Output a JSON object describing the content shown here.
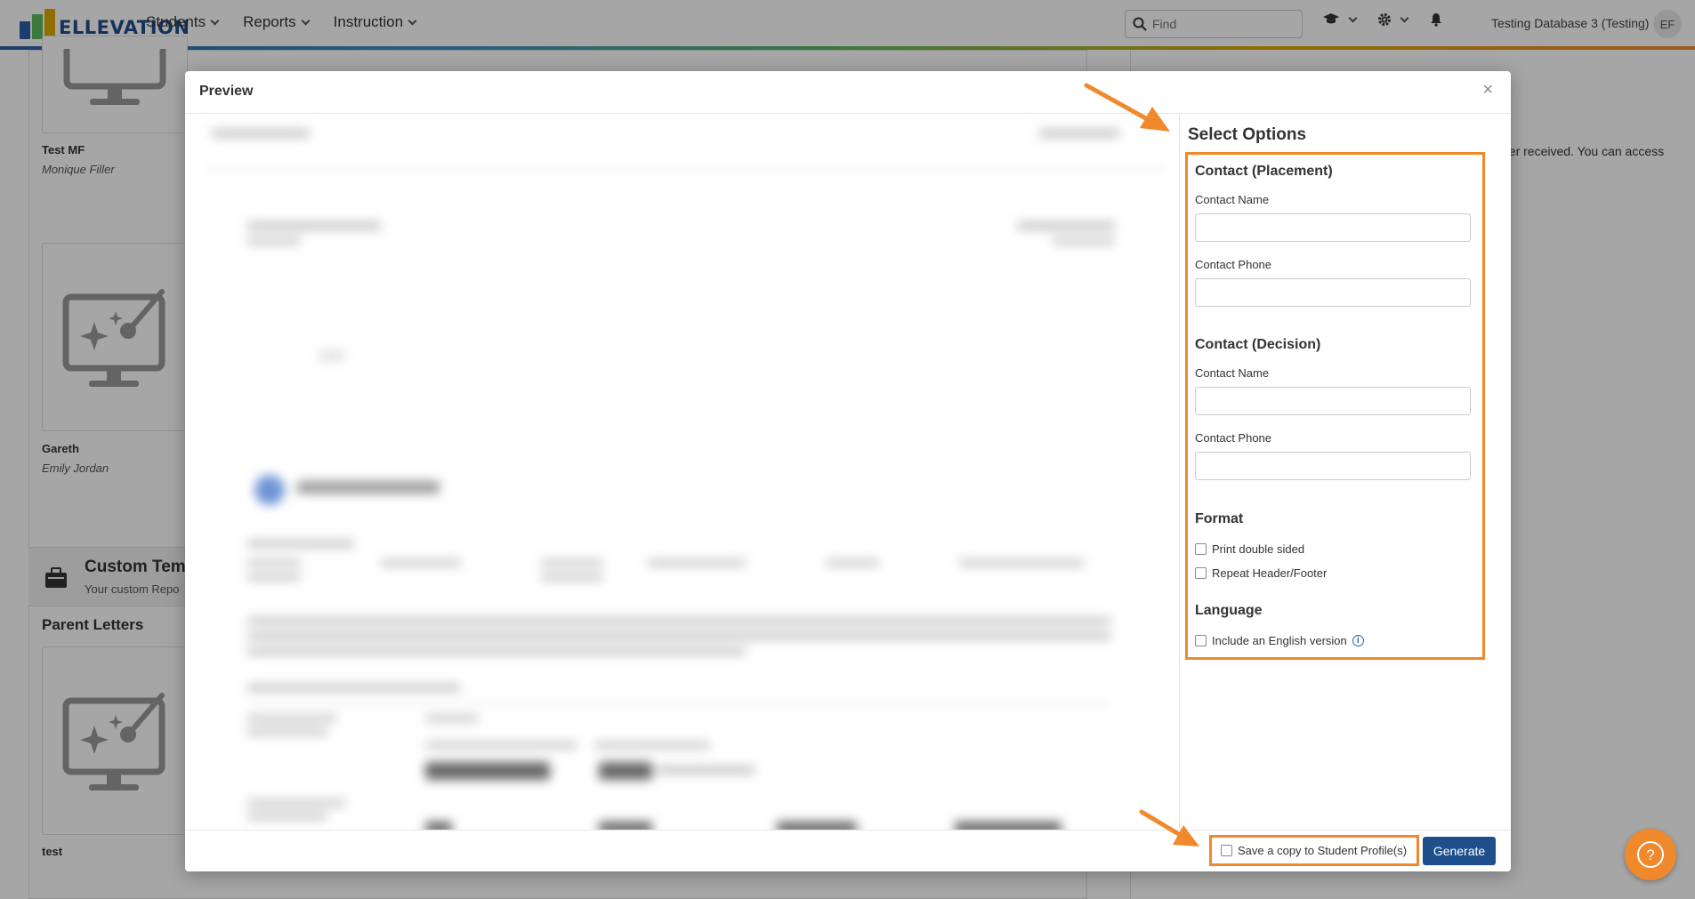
{
  "nav": {
    "logo_text": "ELLEVATION",
    "menu": [
      {
        "label": "Students"
      },
      {
        "label": "Reports"
      },
      {
        "label": "Instruction"
      }
    ],
    "search_placeholder": "Find",
    "database_label": "Testing Database 3 (Testing)",
    "avatar_initials": "EF"
  },
  "background": {
    "tiles": [
      {
        "name": "Test MF",
        "author": "Monique Filler"
      },
      {
        "name": "Gareth",
        "author": "Emily Jordan"
      },
      {
        "name": "test",
        "author": ""
      }
    ],
    "custom_section": {
      "title": "Custom Tem",
      "subtitle": "Your custom Repo"
    },
    "parent_letters_title": "Parent Letters",
    "right_text": "der received. You can access"
  },
  "modal": {
    "title": "Preview",
    "close_label": "×",
    "options": {
      "title": "Select Options",
      "placement": {
        "title": "Contact (Placement)",
        "name_label": "Contact Name",
        "phone_label": "Contact Phone"
      },
      "decision": {
        "title": "Contact (Decision)",
        "name_label": "Contact Name",
        "phone_label": "Contact Phone"
      },
      "format": {
        "title": "Format",
        "print_double": "Print double sided",
        "repeat_header": "Repeat Header/Footer"
      },
      "language": {
        "title": "Language",
        "include_english": "Include an English version"
      }
    },
    "footer": {
      "save_copy_label": "Save a copy to Student Profile(s)",
      "generate_label": "Generate"
    }
  },
  "help_label": "?",
  "colors": {
    "accent": "#f0892b",
    "primary": "#1f4e8c"
  }
}
